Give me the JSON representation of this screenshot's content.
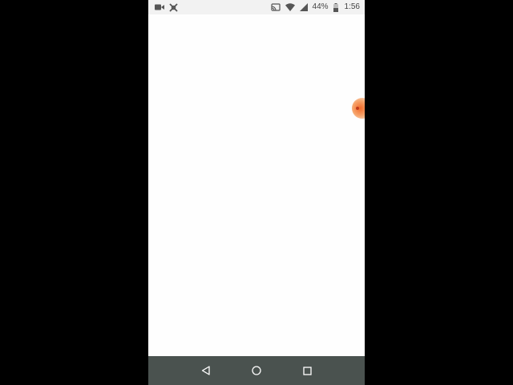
{
  "status_bar": {
    "battery_percent": "44%",
    "time": "1:56",
    "icons": [
      "video-camera-icon",
      "notification-app-icon",
      "cast-icon",
      "wifi-icon",
      "cellular-signal-icon",
      "battery-icon"
    ]
  },
  "colors": {
    "status_bar_bg": "#f2f2f2",
    "content_bg": "#fefefe",
    "nav_bar_bg": "#4a524f",
    "edge_handle": "#f26a2a"
  },
  "nav_bar": {
    "buttons": [
      "back-icon",
      "home-icon",
      "recents-icon"
    ]
  }
}
